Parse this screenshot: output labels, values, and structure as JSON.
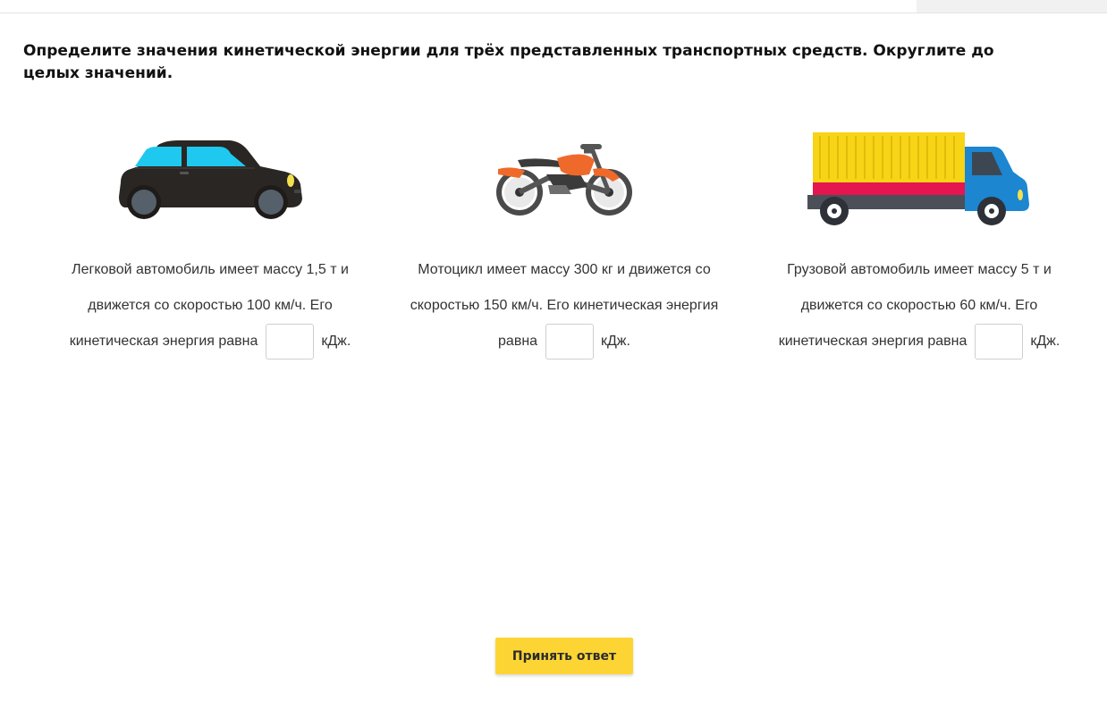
{
  "question": {
    "text": "Определите значения кинетической энергии для трёх представленных транспортных средств. Округлите до целых значений."
  },
  "cards": [
    {
      "icon": "car-icon",
      "text_before": "Легковой автомобиль имеет массу 1,5 т и движется со скоростью 100 км/ч. Его кинетическая энергия равна",
      "answer_value": "",
      "unit": "кДж."
    },
    {
      "icon": "motorcycle-icon",
      "text_before": "Мотоцикл имеет массу 300 кг и движется со скоростью 150 км/ч. Его кинетическая энергия равна",
      "answer_value": "",
      "unit": "кДж."
    },
    {
      "icon": "truck-icon",
      "text_before": "Грузовой автомобиль имеет массу 5 т и движется со скоростью 60 км/ч. Его кинетическая энергия равна",
      "answer_value": "",
      "unit": "кДж."
    }
  ],
  "submit": {
    "label": "Принять ответ"
  },
  "colors": {
    "accent": "#fcd535",
    "car_body": "#2a2624",
    "car_windows": "#1fc8ee",
    "moto_orange": "#ef6a2a",
    "truck_cargo": "#f7d416",
    "truck_stripe": "#e5154f",
    "truck_cab": "#1c86d1"
  }
}
